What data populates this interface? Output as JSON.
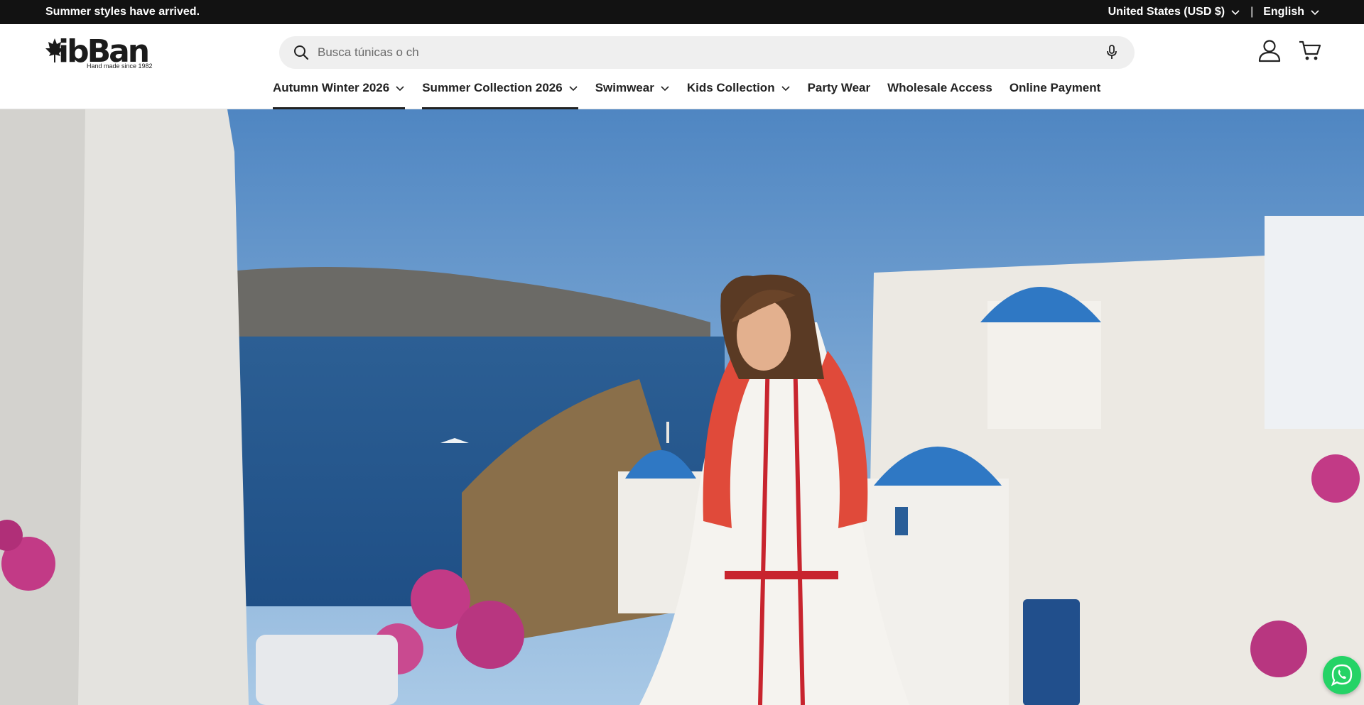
{
  "announcement": {
    "text": "Summer styles have arrived."
  },
  "locale": {
    "country": "United States (USD $)",
    "separator": "|",
    "language": "English"
  },
  "logo": {
    "name": "ibBan",
    "tagline": "Hand made since 1982"
  },
  "search": {
    "placeholder": "Busca túnicas o ch"
  },
  "nav": {
    "items": [
      {
        "label": "Autumn Winter 2026",
        "has_dropdown": true,
        "active": true
      },
      {
        "label": "Summer Collection 2026",
        "has_dropdown": true,
        "active": true
      },
      {
        "label": "Swimwear",
        "has_dropdown": true,
        "active": false
      },
      {
        "label": "Kids Collection",
        "has_dropdown": true,
        "active": false
      },
      {
        "label": "Party Wear",
        "has_dropdown": false,
        "active": false
      },
      {
        "label": "Wholesale Access",
        "has_dropdown": false,
        "active": false
      },
      {
        "label": "Online Payment",
        "has_dropdown": false,
        "active": false
      }
    ]
  },
  "icons": {
    "search": "search-icon",
    "microphone": "microphone-icon",
    "account": "account-icon",
    "cart": "cart-icon",
    "whatsapp": "whatsapp-icon"
  },
  "colors": {
    "topbar_bg": "#121212",
    "search_bg": "#efefef",
    "whatsapp": "#25d366",
    "dome_blue": "#2f78c4"
  }
}
